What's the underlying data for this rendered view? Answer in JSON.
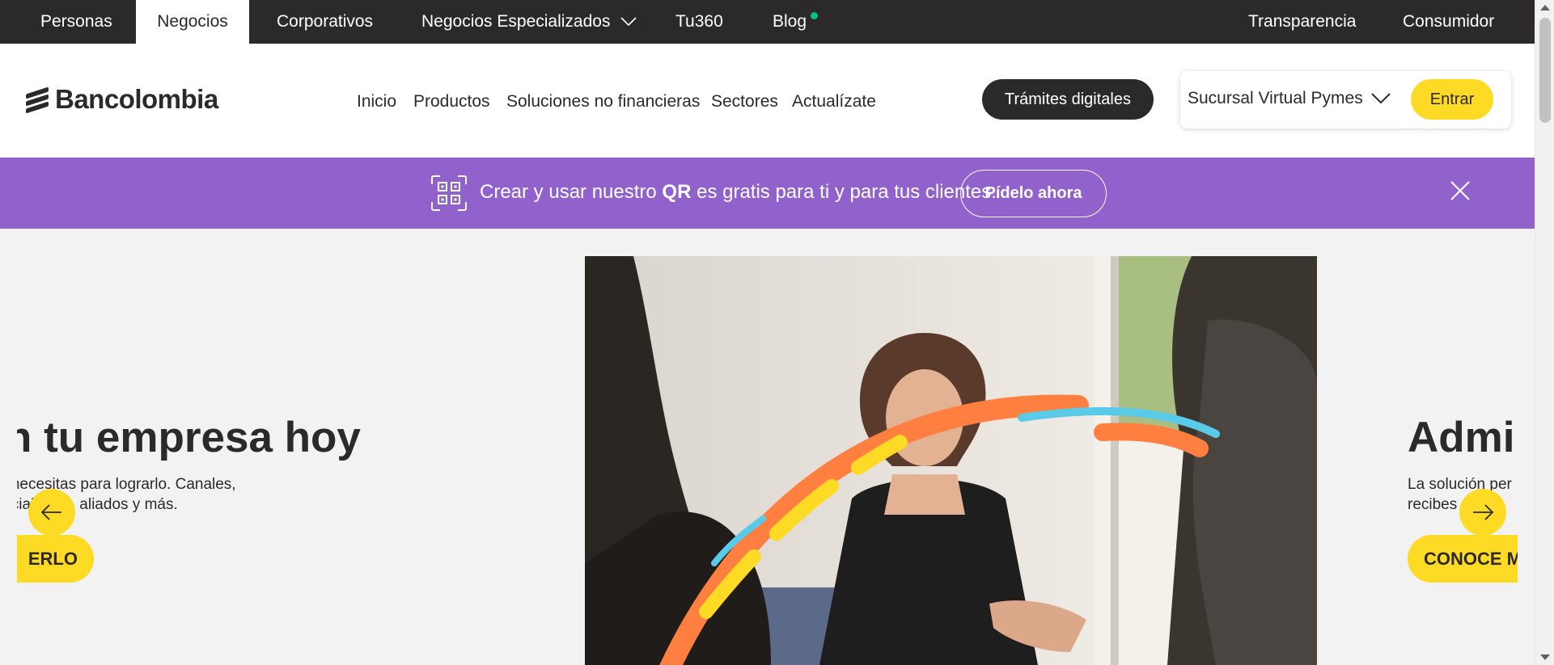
{
  "topbar": {
    "items": [
      {
        "label": "Personas",
        "active": false
      },
      {
        "label": "Negocios",
        "active": true
      },
      {
        "label": "Corporativos",
        "active": false
      },
      {
        "label": "Negocios Especializados",
        "active": false,
        "icon": "chevron-down-icon"
      },
      {
        "label": "Tu360",
        "active": false
      },
      {
        "label": "Blog",
        "active": false,
        "badge": "new-dot"
      }
    ],
    "right_items": [
      {
        "label": "Transparencia"
      },
      {
        "label": "Consumidor"
      }
    ]
  },
  "header": {
    "logo_text": "Bancolombia",
    "nav": [
      "Inicio",
      "Productos",
      "Soluciones no financieras",
      "Sectores",
      "Actualízate"
    ],
    "tramites_button": "Trámites digitales",
    "sucursal": {
      "selected": "Sucursal Virtual Pymes",
      "enter_button": "Entrar"
    }
  },
  "banner": {
    "text_before": "Crear y usar nuestro ",
    "text_bold": "QR",
    "text_after": " es gratis para ti y para tus clientes.",
    "button": "Pídelo ahora",
    "icon": "qr-icon",
    "close_icon": "close-icon"
  },
  "hero": {
    "left_slide": {
      "title": "a con tu empresa hoy",
      "desc_line1": "o que necesitas para lograrlo. Canales,",
      "desc_line2": "sor  pecializada, aliados y más.",
      "button": "ERLO"
    },
    "right_slide": {
      "title": "Admi",
      "desc_line1": "La solución per",
      "desc_line2": "recibes  s c",
      "button": "CONOCE M"
    },
    "prev_icon": "arrow-left-icon",
    "next_icon": "arrow-right-icon"
  },
  "colors": {
    "dark": "#2c2a29",
    "yellow": "#fdda24",
    "purple": "#9262cc",
    "background": "#f2f2f2",
    "dot": "#00c389"
  }
}
